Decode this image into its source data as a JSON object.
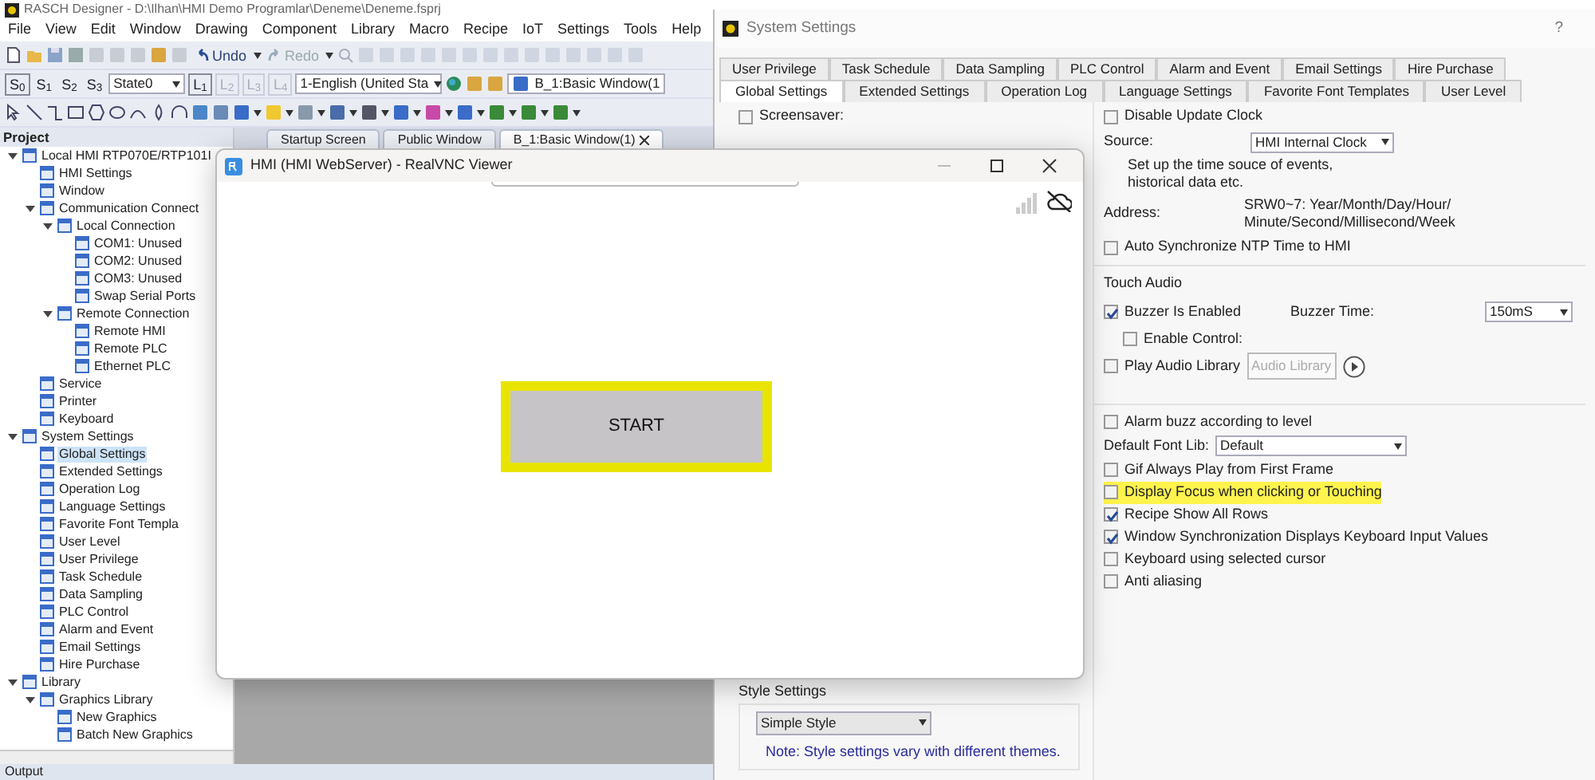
{
  "designer": {
    "title": "RASCH Designer - D:\\Ilhan\\HMI Demo Programlar\\Deneme\\Deneme.fsprj",
    "menu": [
      "File",
      "View",
      "Edit",
      "Window",
      "Drawing",
      "Component",
      "Library",
      "Macro",
      "Recipe",
      "IoT",
      "Settings",
      "Tools",
      "Help"
    ],
    "toolbar": {
      "undo": "Undo",
      "redo": "Redo",
      "states": [
        "S$_{0}$",
        "S$_{1}$",
        "S$_{2}$",
        "S$_{3}$"
      ],
      "state_select": "State0",
      "layers": [
        "L$_{1}$",
        "L$_{2}$",
        "L$_{3}$",
        "L$_{4}$"
      ],
      "language_select": "1-English (United Sta",
      "window_select": "B_1:Basic Window(1"
    },
    "document_tabs": [
      {
        "label": "Startup Screen",
        "selected": false
      },
      {
        "label": "Public Window",
        "selected": false
      },
      {
        "label": "B_1:Basic Window(1)",
        "selected": true
      }
    ],
    "project": {
      "title": "Project",
      "tree": [
        {
          "label": "Local HMI RTP070E/RTP101I",
          "selected": false,
          "expanded": true,
          "children": [
            {
              "label": "HMI Settings",
              "selected": false
            },
            {
              "label": "Window",
              "selected": false
            },
            {
              "label": "Communication Connect",
              "selected": false,
              "expanded": true,
              "children": [
                {
                  "label": "Local Connection",
                  "selected": false,
                  "expanded": true,
                  "children": [
                    {
                      "label": "COM1: Unused",
                      "selected": false
                    },
                    {
                      "label": "COM2: Unused",
                      "selected": false
                    },
                    {
                      "label": "COM3: Unused",
                      "selected": false
                    },
                    {
                      "label": "Swap Serial Ports",
                      "selected": false
                    }
                  ]
                },
                {
                  "label": "Remote Connection",
                  "selected": false,
                  "expanded": true,
                  "children": [
                    {
                      "label": "Remote HMI",
                      "selected": false
                    },
                    {
                      "label": "Remote PLC",
                      "selected": false
                    },
                    {
                      "label": "Ethernet PLC",
                      "selected": false
                    }
                  ]
                }
              ]
            },
            {
              "label": "Service",
              "selected": false
            },
            {
              "label": "Printer",
              "selected": false
            },
            {
              "label": "Keyboard",
              "selected": false
            }
          ]
        },
        {
          "label": "System Settings",
          "selected": false,
          "expanded": true,
          "children": [
            {
              "label": "Global Settings",
              "selected": true
            },
            {
              "label": "Extended Settings",
              "selected": false
            },
            {
              "label": "Operation Log",
              "selected": false
            },
            {
              "label": "Language Settings",
              "selected": false
            },
            {
              "label": "Favorite Font Templa",
              "selected": false
            },
            {
              "label": "User Level",
              "selected": false
            },
            {
              "label": "User Privilege",
              "selected": false
            },
            {
              "label": "Task Schedule",
              "selected": false
            },
            {
              "label": "Data Sampling",
              "selected": false
            },
            {
              "label": "PLC Control",
              "selected": false
            },
            {
              "label": "Alarm and Event",
              "selected": false
            },
            {
              "label": "Email Settings",
              "selected": false
            },
            {
              "label": "Hire Purchase",
              "selected": false
            }
          ]
        },
        {
          "label": "Library",
          "selected": false,
          "expanded": true,
          "children": [
            {
              "label": "Graphics Library",
              "selected": false,
              "expanded": true,
              "children": [
                {
                  "label": "New Graphics",
                  "selected": false
                },
                {
                  "label": "Batch New Graphics",
                  "selected": false
                }
              ]
            }
          ]
        }
      ]
    },
    "output": "Output"
  },
  "settings": {
    "title": "System Settings",
    "help": "?",
    "tabs_row1": [
      {
        "label": "User Privilege",
        "selected": false
      },
      {
        "label": "Task Schedule",
        "selected": false
      },
      {
        "label": "Data Sampling",
        "selected": false
      },
      {
        "label": "PLC Control",
        "selected": false
      },
      {
        "label": "Alarm and Event",
        "selected": false
      },
      {
        "label": "Email Settings",
        "selected": false
      },
      {
        "label": "Hire Purchase",
        "selected": false
      }
    ],
    "tabs_row2": [
      {
        "label": "Global Settings",
        "selected": true
      },
      {
        "label": "Extended Settings",
        "selected": false
      },
      {
        "label": "Operation Log",
        "selected": false
      },
      {
        "label": "Language Settings",
        "selected": false
      },
      {
        "label": "Favorite Font Templates",
        "selected": false
      },
      {
        "label": "User Level",
        "selected": false
      }
    ],
    "screensaver": {
      "label": "Screensaver:",
      "checked": false
    },
    "style": {
      "title": "Style Settings",
      "value": "Simple Style",
      "note": "Note: Style settings vary with different themes."
    },
    "clock": {
      "disable_update": {
        "label": "Disable Update Clock",
        "checked": false
      },
      "source_label": "Source:",
      "source_value": "HMI Internal Clock",
      "description": "Set up the time souce of events, historical data etc.",
      "address_label": "Address:",
      "address_value": "SRW0~7: Year/Month/Day/Hour/ Minute/Second/Millisecond/Week",
      "auto_ntp": {
        "label": "Auto Synchronize NTP Time to HMI",
        "checked": false
      }
    },
    "touch_audio": {
      "title": "Touch Audio",
      "buzzer": {
        "label": "Buzzer Is Enabled",
        "checked": true
      },
      "buzzer_time": {
        "label": "Buzzer Time:",
        "value": "150mS"
      },
      "enable_control": {
        "label": "Enable Control:",
        "checked": false
      },
      "play_audio": {
        "label": "Play Audio Library",
        "checked": false
      },
      "audio_button": {
        "label": "Audio Library",
        "disabled": true
      }
    },
    "options": [
      {
        "kind": "checkbox",
        "label": "Alarm buzz according to level",
        "checked": false,
        "highlighted": false
      },
      {
        "kind": "select",
        "label": "Default Font Lib:",
        "value": "Default"
      },
      {
        "kind": "checkbox",
        "label": "Gif Always Play from First Frame",
        "checked": false,
        "highlighted": false
      },
      {
        "kind": "checkbox",
        "label": "Display Focus when clicking or Touching",
        "checked": false,
        "highlighted": true
      },
      {
        "kind": "checkbox",
        "label": "Recipe Show All Rows",
        "checked": true,
        "highlighted": false
      },
      {
        "kind": "checkbox",
        "label": "Window Synchronization Displays Keyboard Input Values",
        "checked": true,
        "highlighted": false
      },
      {
        "kind": "checkbox",
        "label": "Keyboard using selected cursor",
        "checked": false,
        "highlighted": false
      },
      {
        "kind": "checkbox",
        "label": "Anti aliasing",
        "checked": false,
        "highlighted": false
      }
    ]
  },
  "vnc": {
    "title": "HMI (HMI WebServer) - RealVNC Viewer",
    "start_button": {
      "label": "START",
      "highlighted": true
    }
  }
}
